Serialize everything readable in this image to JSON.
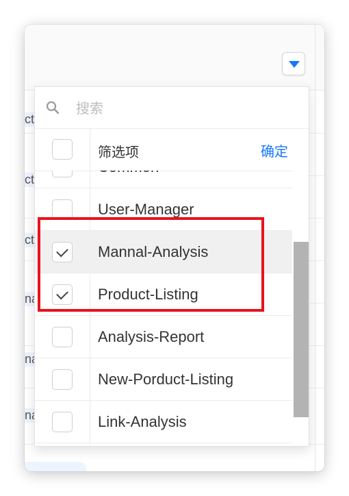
{
  "filter": {
    "search_placeholder": "搜索",
    "header_label": "筛选项",
    "confirm_label": "确定",
    "options": [
      {
        "label": "Common",
        "checked": false
      },
      {
        "label": "User-Manager",
        "checked": false
      },
      {
        "label": "Mannal-Analysis",
        "checked": true
      },
      {
        "label": "Product-Listing",
        "checked": true
      },
      {
        "label": "Analysis-Report",
        "checked": false
      },
      {
        "label": "New-Porduct-Listing",
        "checked": false
      },
      {
        "label": "Link-Analysis",
        "checked": false
      }
    ]
  },
  "background_cells": [
    "ct",
    "ct",
    "ct",
    "na",
    "na",
    "na"
  ],
  "colors": {
    "accent": "#1677ff",
    "highlight": "#e8121d"
  }
}
